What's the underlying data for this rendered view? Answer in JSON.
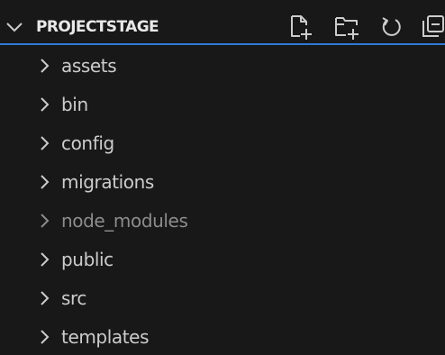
{
  "explorer": {
    "title": "PROJECTSTAGE",
    "expanded_icon": "chevron-down-icon",
    "actions": [
      {
        "name": "new-file-icon"
      },
      {
        "name": "new-folder-icon"
      },
      {
        "name": "refresh-icon"
      },
      {
        "name": "collapse-all-icon"
      }
    ],
    "folders": [
      {
        "label": "assets",
        "dimmed": false
      },
      {
        "label": "bin",
        "dimmed": false
      },
      {
        "label": "config",
        "dimmed": false
      },
      {
        "label": "migrations",
        "dimmed": false
      },
      {
        "label": "node_modules",
        "dimmed": true
      },
      {
        "label": "public",
        "dimmed": false
      },
      {
        "label": "src",
        "dimmed": false
      },
      {
        "label": "templates",
        "dimmed": false
      }
    ]
  },
  "colors": {
    "background": "#181818",
    "text": "#cccccc",
    "dimmed_text": "#8c8c8c",
    "focus_border": "#2b79d8"
  }
}
